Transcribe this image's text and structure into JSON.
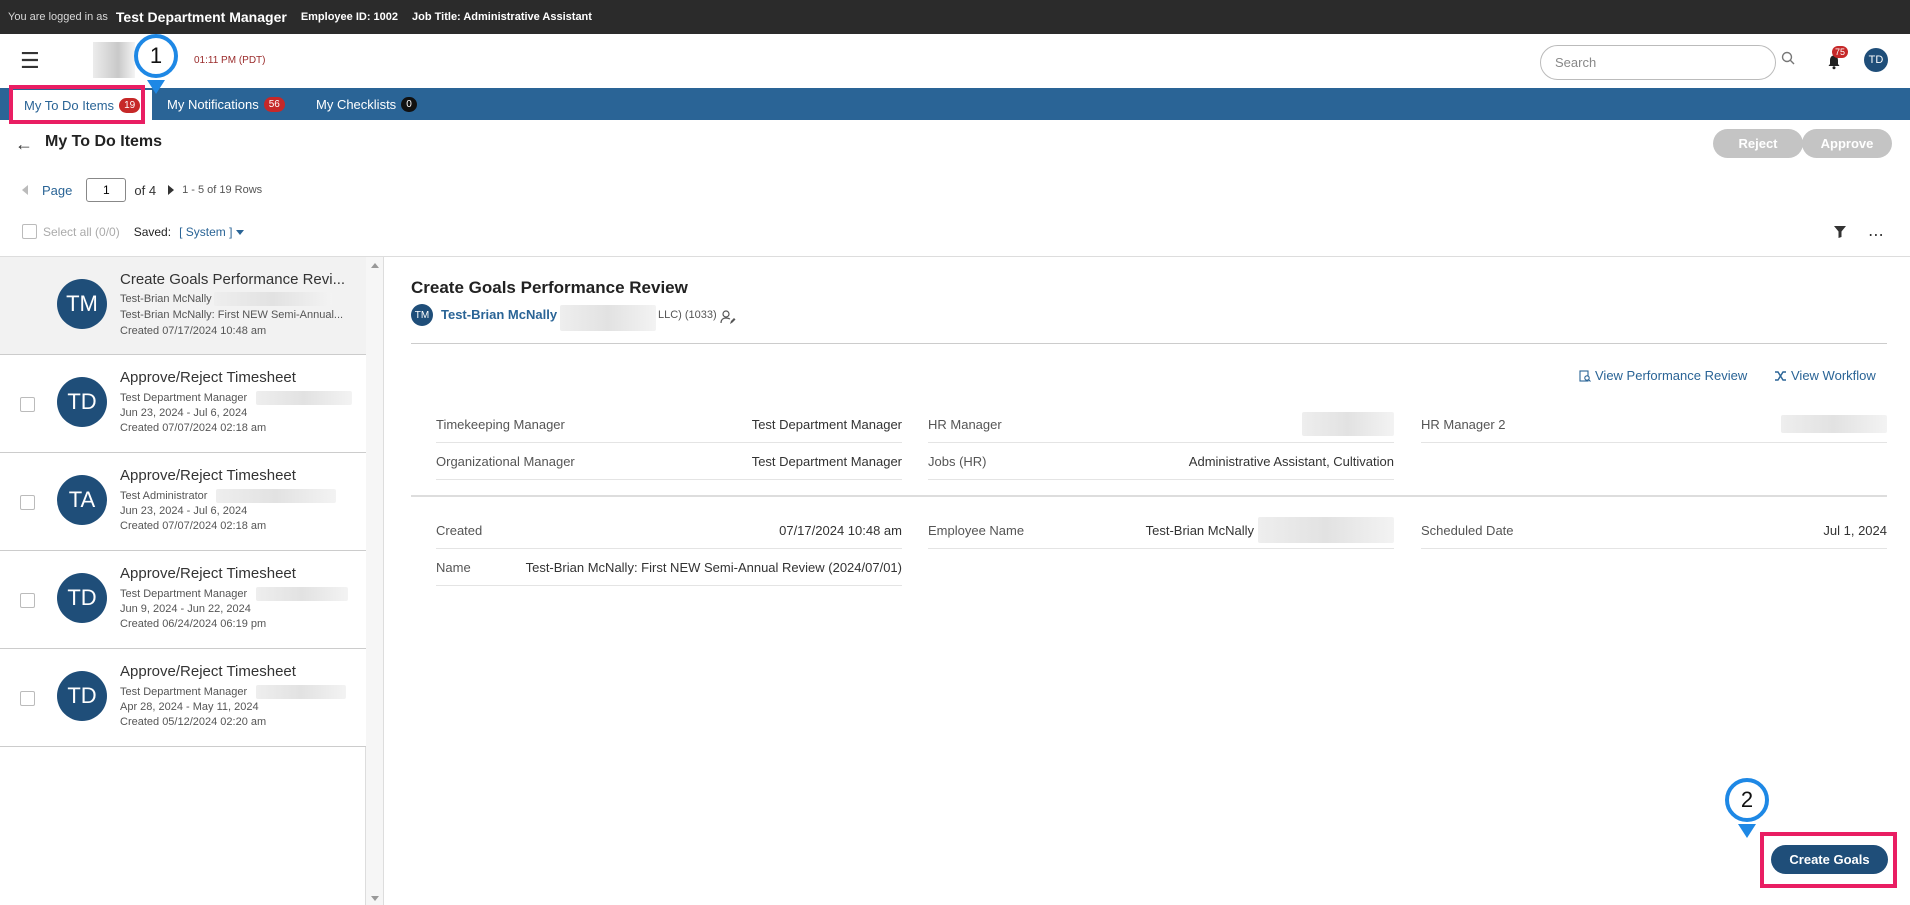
{
  "topbar": {
    "logged_in_prefix": "You are logged in as",
    "user_name": "Test Department Manager",
    "employee_id": "Employee ID: 1002",
    "job_title": "Job Title: Administrative Assistant"
  },
  "header": {
    "time": "01:11 PM (PDT)",
    "search_placeholder": "Search",
    "notifications_count": "75",
    "avatar_initials": "TD"
  },
  "tabs": [
    {
      "label": "My To Do Items",
      "badge": "19"
    },
    {
      "label": "My Notifications",
      "badge": "56"
    },
    {
      "label": "My Checklists",
      "badge": "0"
    }
  ],
  "annotations": {
    "marker1": "1",
    "marker2": "2"
  },
  "page": {
    "title": "My To Do Items",
    "reject_label": "Reject",
    "approve_label": "Approve"
  },
  "pager": {
    "page_label": "Page",
    "current_page": "1",
    "of_label": "of 4",
    "rows_text": "1 - 5 of 19 Rows"
  },
  "selection": {
    "select_all": "Select all (0/0)",
    "saved_label": "Saved:",
    "saved_value": "[ System ]"
  },
  "list": [
    {
      "initials": "TM",
      "title": "Create Goals Performance Revi...",
      "line1": "Test-Brian McNally",
      "line2": "Test-Brian McNally: First NEW Semi-Annual...",
      "line3": "Created 07/17/2024 10:48 am"
    },
    {
      "initials": "TD",
      "title": "Approve/Reject Timesheet",
      "line1": "Test Department Manager",
      "line2": "Jun 23, 2024 - Jul 6, 2024",
      "line3": "Created 07/07/2024 02:18 am"
    },
    {
      "initials": "TA",
      "title": "Approve/Reject Timesheet",
      "line1": "Test Administrator",
      "line2": "Jun 23, 2024 - Jul 6, 2024",
      "line3": "Created 07/07/2024 02:18 am"
    },
    {
      "initials": "TD",
      "title": "Approve/Reject Timesheet",
      "line1": "Test Department Manager",
      "line2": "Jun 9, 2024 - Jun 22, 2024",
      "line3": "Created 06/24/2024 06:19 pm"
    },
    {
      "initials": "TD",
      "title": "Approve/Reject Timesheet",
      "line1": "Test Department Manager",
      "line2": "Apr 28, 2024 - May 11, 2024",
      "line3": "Created 05/12/2024 02:20 am"
    }
  ],
  "detail": {
    "title": "Create Goals Performance Review",
    "employee_initials": "TM",
    "employee_name": "Test-Brian McNally",
    "employee_suffix": "LLC) (1033)",
    "view_review": "View Performance Review",
    "view_workflow": "View Workflow",
    "fields": {
      "timekeeping_manager_label": "Timekeeping Manager",
      "timekeeping_manager_value": "Test Department Manager",
      "hr_manager_label": "HR Manager",
      "hr_manager2_label": "HR Manager 2",
      "org_manager_label": "Organizational Manager",
      "org_manager_value": "Test Department Manager",
      "jobs_label": "Jobs (HR)",
      "jobs_value": "Administrative Assistant, Cultivation",
      "created_label": "Created",
      "created_value": "07/17/2024 10:48 am",
      "employee_name_label": "Employee Name",
      "employee_name_value": "Test-Brian McNally",
      "scheduled_label": "Scheduled Date",
      "scheduled_value": "Jul 1, 2024",
      "name_label": "Name",
      "name_value": "Test-Brian McNally: First NEW Semi-Annual Review (2024/07/01)"
    },
    "create_goals_label": "Create Goals"
  },
  "colors": {
    "brand_blue": "#2a6496",
    "avatar_navy": "#1f4e79",
    "badge_red": "#c62828",
    "highlight_pink": "#e91e63",
    "marker_blue": "#1e88e5"
  }
}
